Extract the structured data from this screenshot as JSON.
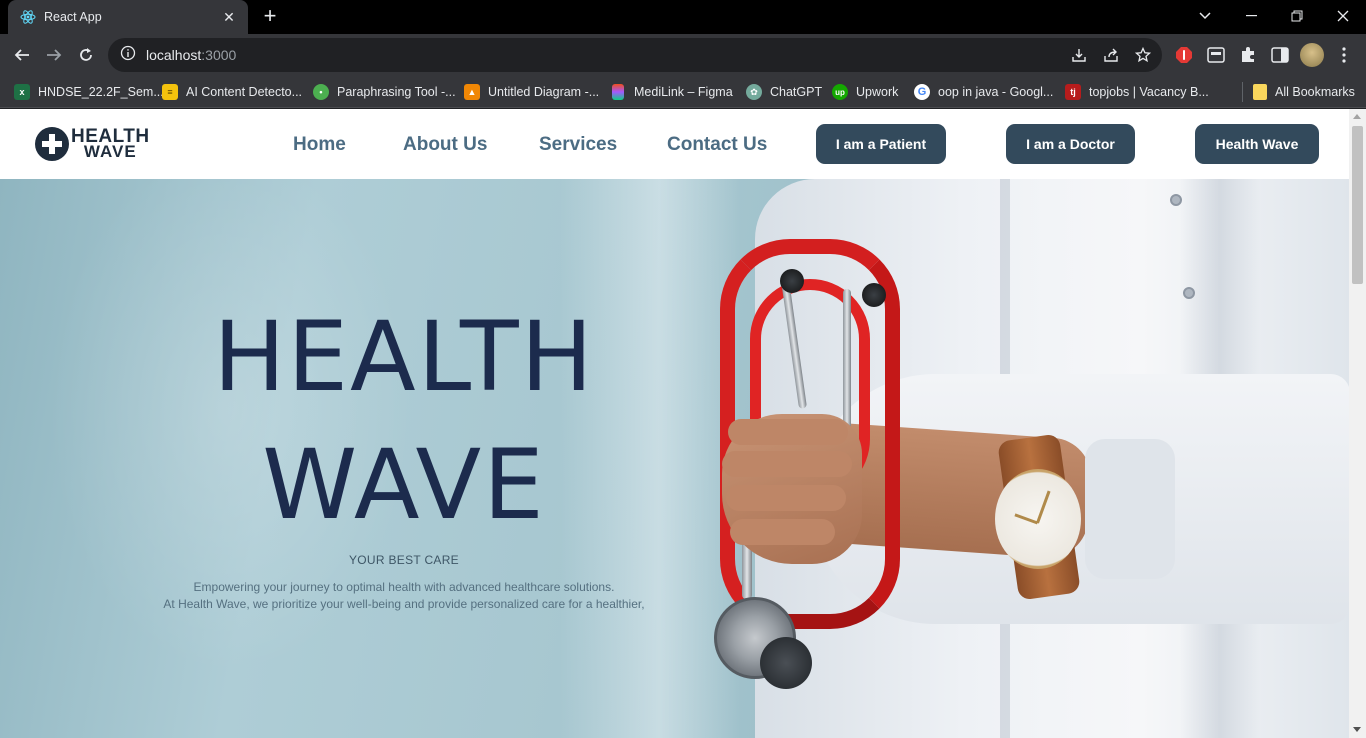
{
  "browser": {
    "tab": {
      "title": "React App",
      "favicon": "react-icon"
    },
    "address": {
      "host": "localhost",
      "port": ":3000"
    },
    "bookmarks": [
      {
        "label": "HNDSE_22.2F_Sem...",
        "icon": "excel-icon",
        "color": "#1e7145"
      },
      {
        "label": "AI Content Detecto...",
        "icon": "document-icon",
        "color": "#f4c20d"
      },
      {
        "label": "Paraphrasing Tool -...",
        "icon": "robot-icon",
        "color": "#4caf50"
      },
      {
        "label": "Untitled Diagram -...",
        "icon": "diagram-icon",
        "color": "#f08705"
      },
      {
        "label": "MediLink – Figma",
        "icon": "figma-icon",
        "color": "#a259ff"
      },
      {
        "label": "ChatGPT",
        "icon": "openai-icon",
        "color": "#74aa9c"
      },
      {
        "label": "Upwork",
        "icon": "upwork-icon",
        "color": "#14a800"
      },
      {
        "label": "oop in java - Googl...",
        "icon": "google-icon",
        "color": "#ffffff"
      },
      {
        "label": "topjobs | Vacancy B...",
        "icon": "topjobs-icon",
        "color": "#b71c1c"
      }
    ],
    "all_bookmarks": "All Bookmarks"
  },
  "site": {
    "logo": {
      "line1": "HEALTH",
      "line2": "WAVE"
    },
    "nav": [
      "Home",
      "About Us",
      "Services",
      "Contact Us"
    ],
    "cta": [
      "I am a Patient",
      "I am a Doctor",
      "Health Wave"
    ]
  },
  "hero": {
    "title_line1": "HEALTH",
    "title_line2": "WAVE",
    "tagline": "YOUR BEST CARE",
    "desc_line1": "Empowering your journey to optimal health with advanced healthcare solutions.",
    "desc_line2": "At Health Wave, we prioritize your well-being and provide personalized care for a healthier,"
  },
  "colors": {
    "nav_link": "#4c6c83",
    "cta_bg": "#334a5c",
    "hero_title": "#1c2b4d"
  }
}
